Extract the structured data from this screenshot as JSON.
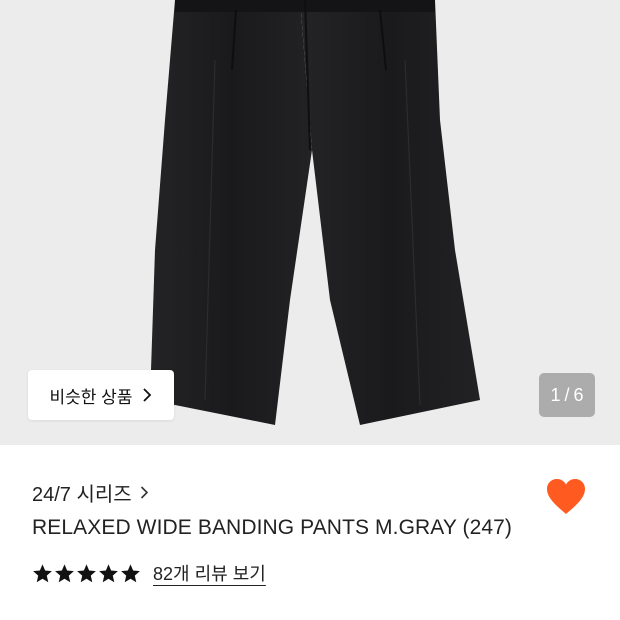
{
  "gallery": {
    "similar_products_label": "비슷한 상품",
    "current_image": "1",
    "separator": "/",
    "total_images": "6"
  },
  "product": {
    "series_label": "24/7 시리즈",
    "name": "RELAXED WIDE BANDING PANTS M.GRAY (247)",
    "rating_stars": 5,
    "review_link_label": "82개 리뷰 보기",
    "liked": true
  },
  "colors": {
    "heart": "#ff5a1f",
    "stars": "#111111",
    "gallery_bg": "#ececec",
    "garment": "#1c1c1e"
  },
  "icons": {
    "similar_chevron": "chevron-right-icon",
    "series_chevron": "chevron-right-icon",
    "like": "heart-icon",
    "rating": "star-icon"
  }
}
